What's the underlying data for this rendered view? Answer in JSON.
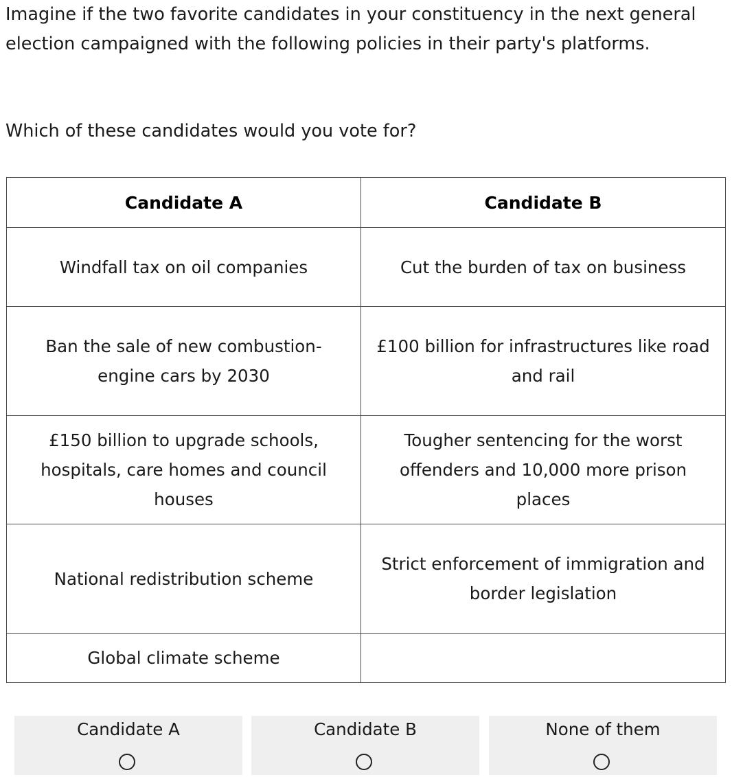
{
  "intro_text": "Imagine if the two favorite candidates in your constituency in the next general election campaigned with the following policies in their party's platforms.",
  "question_text": "Which of these candidates would you vote for?",
  "table": {
    "headers": [
      "Candidate A",
      "Candidate B"
    ],
    "rows": [
      [
        "Windfall tax on oil companies",
        "Cut the burden of tax on business"
      ],
      [
        "Ban the sale of new combustion-engine cars by 2030",
        "£100 billion for infrastructures like road and rail"
      ],
      [
        "£150 billion to upgrade schools, hospitals, care homes and council houses",
        "Tougher sentencing for the worst offenders and 10,000 more prison places"
      ],
      [
        "National redistribution scheme",
        "Strict enforcement of immigration and border legislation"
      ],
      [
        "Global climate scheme",
        ""
      ]
    ]
  },
  "answers": [
    {
      "label": "Candidate A",
      "selected": false
    },
    {
      "label": "Candidate B",
      "selected": false
    },
    {
      "label": "None of them",
      "selected": false
    }
  ],
  "colors": {
    "answer_background": "#efefef",
    "border": "#4a4a4a"
  }
}
